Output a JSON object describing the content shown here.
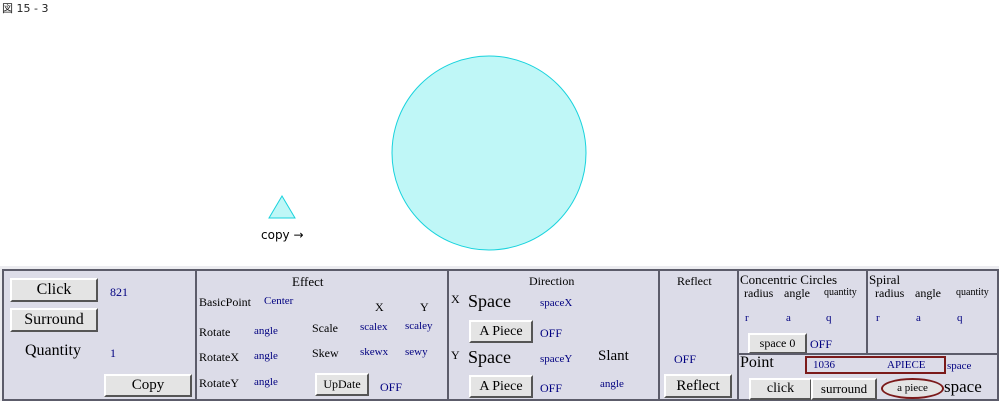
{
  "figure_label": "図 15 - 3",
  "copy_label": "copy →",
  "colors": {
    "shape_fill": "#bff7f7",
    "shape_stroke": "#19d3dd",
    "panel_bg": "#dcdce8",
    "value_text": "#000080",
    "highlight_border": "#7b1a1a"
  },
  "left_panel": {
    "click_button": "Click",
    "click_value": "821",
    "surround_button": "Surround",
    "quantity_label": "Quantity",
    "quantity_value": "1",
    "copy_button": "Copy"
  },
  "effect_panel": {
    "title": "Effect",
    "basic_point_label": "BasicPoint",
    "basic_point_value": "Center",
    "x_header": "X",
    "y_header": "Y",
    "rotate_label": "Rotate",
    "rotate_value": "angle",
    "scale_label": "Scale",
    "scale_x": "scalex",
    "scale_y": "scaley",
    "rotatex_label": "RotateX",
    "rotatex_value": "angle",
    "skew_label": "Skew",
    "skew_x": "skewx",
    "skew_y": "sewy",
    "rotatey_label": "RotateY",
    "rotatey_value": "angle",
    "update_button": "UpDate",
    "update_status": "OFF"
  },
  "direction_panel": {
    "title": "Direction",
    "x_marker": "X",
    "x_space_label": "Space",
    "x_space_value": "spaceX",
    "x_piece_button": "A Piece",
    "x_piece_status": "OFF",
    "y_marker": "Y",
    "y_space_label": "Space",
    "y_space_value": "spaceY",
    "slant_label": "Slant",
    "y_piece_button": "A Piece",
    "y_piece_status": "OFF",
    "slant_value": "angle"
  },
  "reflect_panel": {
    "title": "Reflect",
    "status": "OFF",
    "reflect_button": "Reflect"
  },
  "concentric_panel": {
    "title": "Concentric Circles",
    "radius_label": "radius",
    "angle_label": "angle",
    "quantity_label": "quantity",
    "r_value": "r",
    "a_value": "a",
    "q_value": "q",
    "space_button": "space 0",
    "status": "OFF"
  },
  "spiral_panel": {
    "title": "Spiral",
    "radius_label": "radius",
    "angle_label": "angle",
    "quantity_label": "quantity",
    "r_value": "r",
    "a_value": "a",
    "q_value": "q"
  },
  "point_panel": {
    "title": "Point",
    "value_number": "1036",
    "value_mode": "APIECE",
    "space_small": "space",
    "click_button": "click",
    "surround_button": "surround",
    "apiece_button": "a piece",
    "space_large": "space"
  }
}
